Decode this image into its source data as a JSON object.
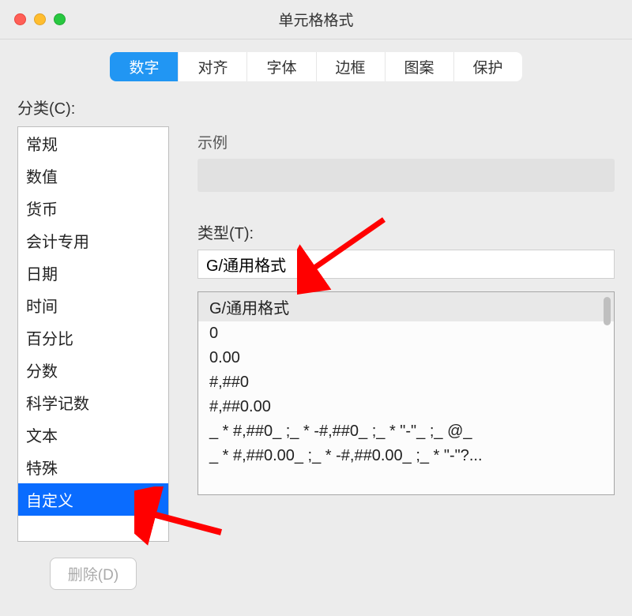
{
  "window": {
    "title": "单元格格式"
  },
  "tabs": {
    "items": [
      {
        "label": "数字",
        "active": true
      },
      {
        "label": "对齐"
      },
      {
        "label": "字体"
      },
      {
        "label": "边框"
      },
      {
        "label": "图案"
      },
      {
        "label": "保护"
      }
    ]
  },
  "labels": {
    "category": "分类(C):",
    "sample": "示例",
    "type": "类型(T):",
    "delete": "删除(D)"
  },
  "categories": [
    "常规",
    "数值",
    "货币",
    "会计专用",
    "日期",
    "时间",
    "百分比",
    "分数",
    "科学记数",
    "文本",
    "特殊",
    "自定义"
  ],
  "selected_category_index": 11,
  "type_input_value": "G/通用格式",
  "type_list": [
    "G/通用格式",
    "0",
    "0.00",
    "#,##0",
    "#,##0.00",
    "_ * #,##0_ ;_ * -#,##0_ ;_ * \"-\"_ ;_ @_",
    "_ * #,##0.00_ ;_ * -#,##0.00_ ;_ * \"-\"?..."
  ],
  "selected_type_index": 0
}
